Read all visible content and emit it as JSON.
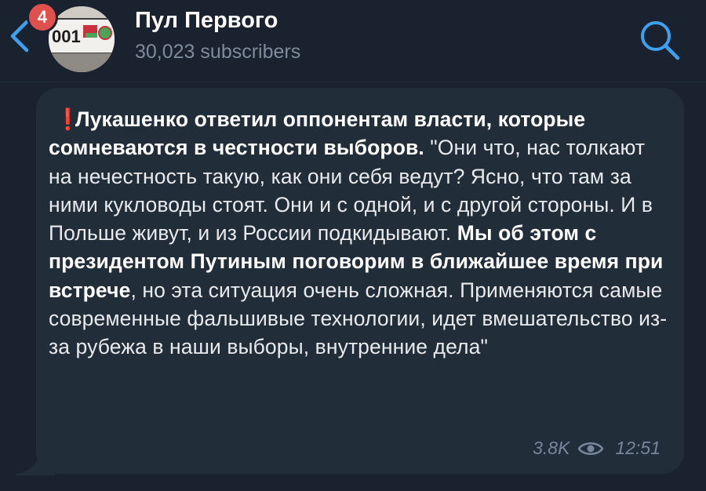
{
  "header": {
    "back_icon": "chevron-left-icon",
    "unread_badge": "4",
    "avatar_plate_text": "001",
    "title": "Пул Первого",
    "subscribers": "30,023 subscribers",
    "search_icon": "search-icon"
  },
  "message": {
    "emoji": "❗",
    "bold_intro": "Лукашенко ответил оппонентам власти, которые сомневаются в честности выборов.",
    "text_part1": " \"Они что, нас толкают на нечестность такую, как они себя ведут? Ясно, что там за ними кукловоды стоят. Они и с одной, и с другой стороны. И в Польше живут, и из России подкидывают. ",
    "bold_middle": "Мы об этом с президентом Путиным поговорим в ближайшее время при встрече",
    "text_part2": ", но эта ситуация очень сложная. Применяются самые современные фальшивые технологии, идет вмешательство из-за рубежа в наши выборы, внутренние дела\"",
    "views": "3.8K",
    "views_icon": "eye-icon",
    "time": "12:51"
  },
  "colors": {
    "background": "#19222e",
    "bubble": "#222d3a",
    "accent": "#3ea1f0",
    "badge": "#e0504c",
    "meta_text": "#77869a"
  }
}
